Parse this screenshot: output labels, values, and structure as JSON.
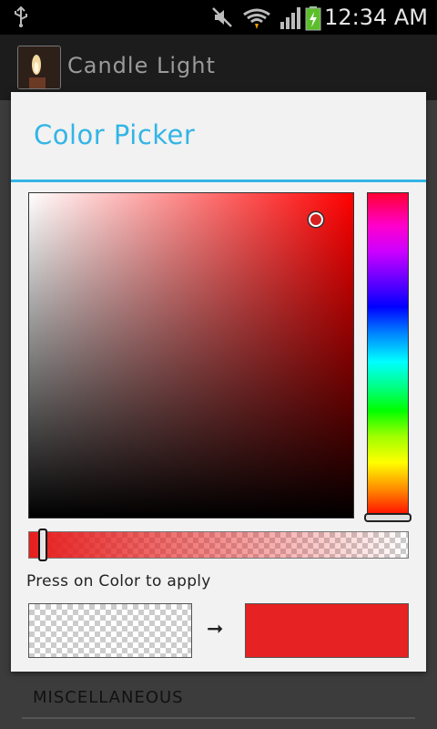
{
  "status_bar": {
    "time": "12:34 AM",
    "icons": [
      "usb-icon",
      "mute-icon",
      "wifi-icon",
      "signal-icon",
      "battery-charging-icon"
    ]
  },
  "app_bar": {
    "title": "Candle Light",
    "icon": "candle-app-icon"
  },
  "dialog": {
    "title": "Color Picker",
    "accent_color": "#33b5e5",
    "hue_hex": "#ff0000",
    "selected_color_hex": "#e62222",
    "hint": "Press on Color to apply",
    "arrow": "➞"
  },
  "background_list": {
    "section_header": "MISCELLANEOUS"
  }
}
